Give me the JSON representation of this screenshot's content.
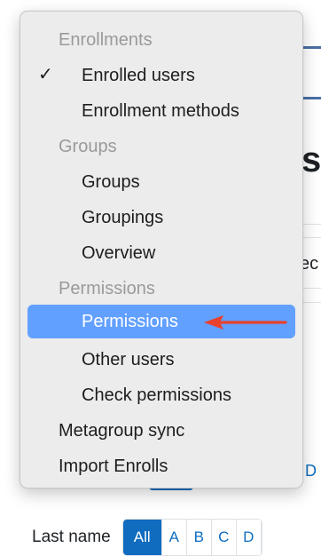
{
  "background": {
    "heading_fragment": "s",
    "fragment_text": "ec",
    "tab_fragment": "D"
  },
  "menu": {
    "sections": [
      {
        "header": "Enrollments",
        "items": [
          {
            "label": "Enrolled users",
            "checked": true
          },
          {
            "label": "Enrollment methods",
            "checked": false
          }
        ]
      },
      {
        "header": "Groups",
        "items": [
          {
            "label": "Groups"
          },
          {
            "label": "Groupings"
          },
          {
            "label": "Overview"
          }
        ]
      },
      {
        "header": "Permissions",
        "items": [
          {
            "label": "Permissions",
            "highlighted": true
          },
          {
            "label": "Other users"
          },
          {
            "label": "Check permissions"
          }
        ]
      }
    ],
    "top_level_items": [
      {
        "label": "Metagroup sync"
      },
      {
        "label": "Import Enrolls"
      }
    ],
    "check_glyph": "✓",
    "highlight_color": "#62a0ff"
  },
  "filter": {
    "label": "Last name",
    "letters": [
      "All",
      "A",
      "B",
      "C",
      "D"
    ],
    "active": "All",
    "accent_color": "#0f6cbf"
  },
  "annotation": {
    "arrow_color": "#e8412c",
    "arrow_icon": "red-arrow-left"
  }
}
